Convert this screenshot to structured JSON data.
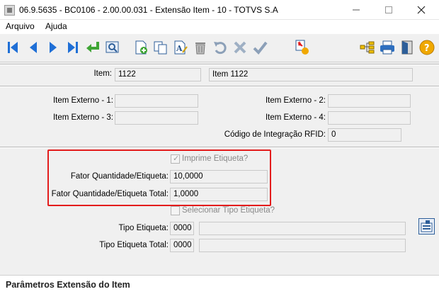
{
  "window": {
    "title": "06.9.5635 - BC0106 - 2.00.00.031 - Extensão Item - 10 - TOTVS S.A",
    "minimize_icon": "minimize-icon",
    "maximize_icon": "maximize-icon",
    "close_icon": "close-icon"
  },
  "menu": {
    "items": [
      {
        "label": "Arquivo"
      },
      {
        "label": "Ajuda"
      }
    ]
  },
  "toolbar": {
    "buttons": [
      {
        "icon": "first-record-icon"
      },
      {
        "icon": "previous-record-icon"
      },
      {
        "icon": "next-record-icon"
      },
      {
        "icon": "last-record-icon"
      },
      {
        "icon": "go-to-icon"
      },
      {
        "icon": "search-icon"
      },
      {
        "icon": "new-record-icon"
      },
      {
        "icon": "copy-record-icon"
      },
      {
        "icon": "edit-record-icon"
      },
      {
        "icon": "delete-icon"
      },
      {
        "icon": "undo-icon"
      },
      {
        "icon": "cancel-icon"
      },
      {
        "icon": "save-icon"
      },
      {
        "icon": "query-icon"
      },
      {
        "icon": "navigate-icon"
      },
      {
        "icon": "print-icon"
      },
      {
        "icon": "exit-icon"
      },
      {
        "icon": "help-icon"
      }
    ],
    "colors": {
      "nav": "#1f6fd6",
      "green": "#3fa535",
      "help": "#f0a800"
    }
  },
  "form": {
    "item": {
      "label": "Item:",
      "code": "1122",
      "description": "Item 1122"
    },
    "external_1": {
      "label": "Item Externo - 1:",
      "value": ""
    },
    "external_2": {
      "label": "Item Externo - 2:",
      "value": ""
    },
    "external_3": {
      "label": "Item Externo - 3:",
      "value": ""
    },
    "external_4": {
      "label": "Item Externo - 4:",
      "value": ""
    },
    "rfid": {
      "label": "Código de Integração RFID:",
      "value": "0"
    },
    "print_label": {
      "label": "Imprime Etiqueta?",
      "checked": true
    },
    "qty_factor": {
      "label": "Fator Quantidade/Etiqueta:",
      "value": "10,0000"
    },
    "qty_factor_total": {
      "label": "Fator Quantidade/Etiqueta Total:",
      "value": "1,0000"
    },
    "select_label_type": {
      "label": "Selecionar Tipo Etiqueta?",
      "checked": false
    },
    "label_type": {
      "label": "Tipo Etiqueta:",
      "code": "0000",
      "description": ""
    },
    "label_type_total": {
      "label": "Tipo Etiqueta Total:",
      "code": "0000",
      "description": ""
    }
  },
  "status": {
    "text": "Parâmetros Extensão do Item"
  },
  "highlight_color": "#e31c1c"
}
